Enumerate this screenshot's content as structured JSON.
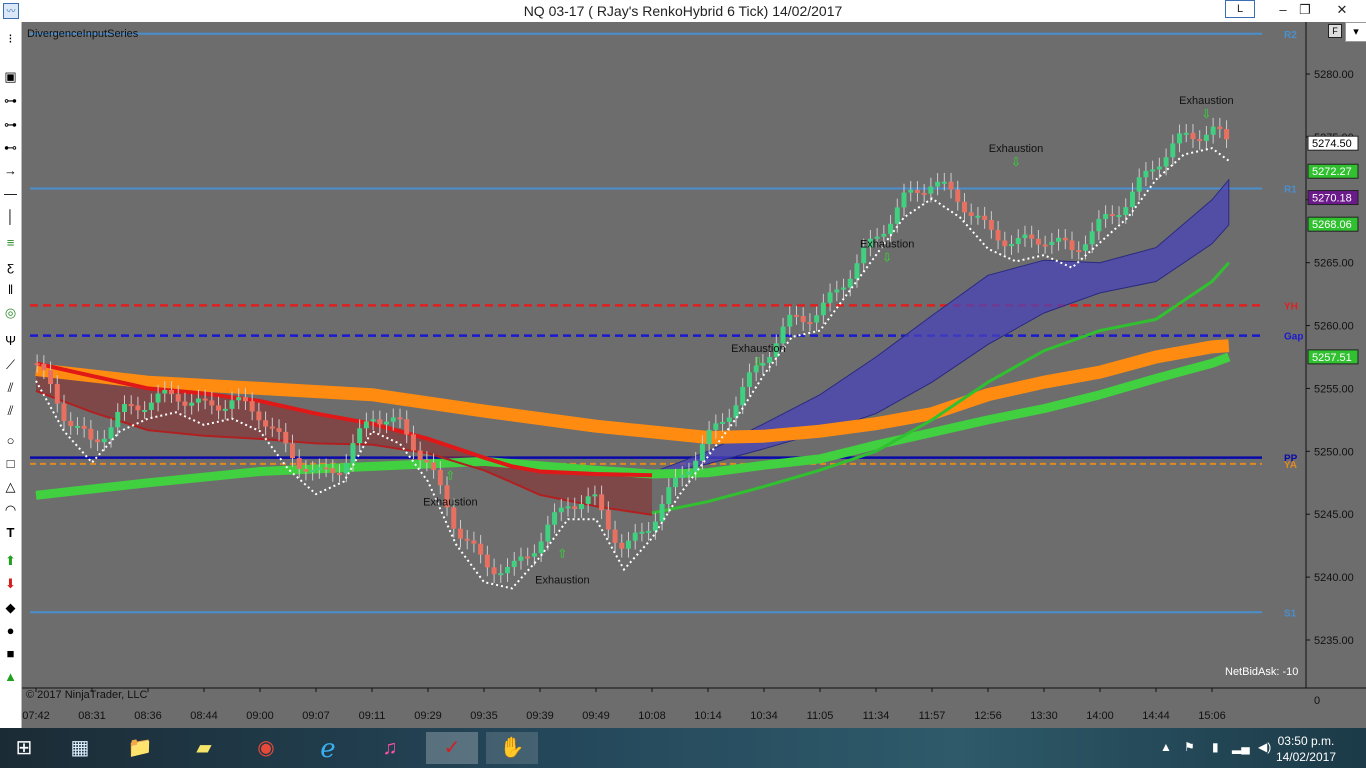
{
  "window": {
    "title": "NQ 03-17 ( RJay's RenkoHybrid  6 Tick)  14/02/2017",
    "badge": "L",
    "minimize": "–",
    "maximize": "❐",
    "close": "✕"
  },
  "chart": {
    "indicator_label": "DivergenceInputSeries",
    "copyright": "© 2017 NinjaTrader, LLC",
    "netbid": "NetBidAsk: -10",
    "f_button": "F",
    "dropdown": "▾",
    "colors": {
      "background": "#6d6d6d",
      "level_blue": "#4a8fd0",
      "yh": "#e02020",
      "gap": "#1a1ad0",
      "pp": "#0a0aa8",
      "ya": "#e08a20",
      "orange_band": "#ff8c10",
      "green_band": "#40d040",
      "up_candle": "#40d080",
      "down_candle": "#e87060"
    }
  },
  "chart_data": {
    "type": "line",
    "title": "NQ 03-17 ( RJay's RenkoHybrid  6 Tick)  14/02/2017",
    "x_ticks": [
      "07:42",
      "08:31",
      "08:36",
      "08:44",
      "09:00",
      "09:07",
      "09:11",
      "09:29",
      "09:35",
      "09:39",
      "09:49",
      "10:08",
      "10:14",
      "10:34",
      "11:05",
      "11:34",
      "11:57",
      "12:56",
      "13:30",
      "14:00",
      "14:44",
      "15:06"
    ],
    "y_ticks": [
      "5280.00",
      "5275.00",
      "5270.00",
      "5265.00",
      "5260.00",
      "5255.00",
      "5250.00",
      "5245.00",
      "5240.00",
      "5235.00"
    ],
    "ylim": [
      5231.5,
      5283.5
    ],
    "levels": [
      {
        "name": "R2",
        "value": 5283.2
      },
      {
        "name": "R1",
        "value": 5270.9
      },
      {
        "name": "YH",
        "value": 5261.6
      },
      {
        "name": "Gap",
        "value": 5259.2
      },
      {
        "name": "PP",
        "value": 5249.5
      },
      {
        "name": "YA",
        "value": 5249.0
      },
      {
        "name": "S1",
        "value": 5237.2
      }
    ],
    "price_tags": [
      {
        "label": "5274.50",
        "value": 5274.5,
        "color": "#ffffff",
        "text": "#000000"
      },
      {
        "label": "5272.27",
        "value": 5272.27,
        "color": "#30c030",
        "text": "#ffffff"
      },
      {
        "label": "5270.18",
        "value": 5270.18,
        "color": "#6a1a8a",
        "text": "#ffffff"
      },
      {
        "label": "5268.06",
        "value": 5268.06,
        "color": "#30c030",
        "text": "#ffffff"
      },
      {
        "label": "5257.51",
        "value": 5257.51,
        "color": "#30c030",
        "text": "#ffffff"
      }
    ],
    "annotations": [
      {
        "text": "Exhaustion",
        "x_index": 20.9,
        "value": 5277.6,
        "arrow": "down"
      },
      {
        "text": "Exhaustion",
        "x_index": 17.5,
        "value": 5273.8,
        "arrow": "down"
      },
      {
        "text": "Exhaustion",
        "x_index": 15.2,
        "value": 5266.2,
        "arrow": "down"
      },
      {
        "text": "Exhaustion",
        "x_index": 12.9,
        "value": 5257.9,
        "arrow": "down"
      },
      {
        "text": "Exhaustion",
        "x_index": 7.4,
        "value": 5245.7,
        "arrow": "up"
      },
      {
        "text": "Exhaustion",
        "x_index": 9.4,
        "value": 5239.5,
        "arrow": "up"
      }
    ],
    "series": [
      {
        "name": "close",
        "x": [
          0,
          0.5,
          1,
          1.5,
          2,
          2.5,
          3,
          3.5,
          4,
          4.5,
          5,
          5.5,
          6,
          6.5,
          7,
          7.5,
          8,
          8.5,
          9,
          9.5,
          10,
          10.5,
          11,
          11.5,
          12,
          12.5,
          13,
          13.5,
          14,
          14.5,
          15,
          15.5,
          16,
          16.5,
          17,
          17.5,
          18,
          18.5,
          19,
          19.5,
          20,
          20.5,
          21,
          21.3
        ],
        "y": [
          5257,
          5253,
          5250.5,
          5253,
          5254,
          5254.5,
          5253.5,
          5254,
          5253,
          5250,
          5248,
          5249,
          5253,
          5252,
          5249,
          5244,
          5241,
          5240.5,
          5243,
          5246,
          5246,
          5242,
          5244.5,
          5248,
          5251,
          5254,
          5257.5,
          5260.5,
          5261,
          5264,
          5267,
          5270,
          5271.5,
          5270,
          5267.5,
          5266.5,
          5267,
          5266,
          5268,
          5270,
          5273,
          5275,
          5275.5,
          5274.5
        ]
      },
      {
        "name": "orange_band",
        "x": [
          0,
          2,
          4,
          6,
          8,
          10,
          12,
          13,
          14,
          15,
          16,
          17,
          18,
          19,
          20,
          21,
          21.3
        ],
        "y": [
          5256.5,
          5255.5,
          5255,
          5254.5,
          5253.2,
          5252,
          5251.1,
          5251.2,
          5251.6,
          5252.2,
          5253,
          5254.5,
          5255.5,
          5256.3,
          5257.5,
          5258.3,
          5258.4
        ]
      },
      {
        "name": "green_band",
        "x": [
          0,
          2,
          4,
          6,
          8,
          10,
          11,
          12,
          13,
          14,
          15,
          16,
          17,
          18,
          19,
          20,
          21,
          21.3
        ],
        "y": [
          5246.5,
          5247.5,
          5248.4,
          5248.8,
          5249.2,
          5248.5,
          5248.2,
          5248.3,
          5248.9,
          5249.4,
          5250.5,
          5251.5,
          5252.5,
          5253.4,
          5254.5,
          5255.8,
          5257,
          5257.5
        ]
      },
      {
        "name": "red_band",
        "x": [
          0,
          1,
          2,
          3,
          4,
          5,
          6,
          7,
          8,
          8.5,
          9,
          10,
          11
        ],
        "y": [
          5257,
          5256,
          5255,
          5254.6,
          5254,
          5253,
          5252.2,
          5251,
          5249.5,
          5248.8,
          5248.4,
          5248.2,
          5248.1
        ]
      },
      {
        "name": "purple_upper",
        "x": [
          11,
          12,
          13,
          14,
          15,
          16,
          17,
          18,
          19,
          20,
          21,
          21.3
        ],
        "y": [
          5248.3,
          5250,
          5252.2,
          5254.5,
          5257.5,
          5260.8,
          5264,
          5265.2,
          5265,
          5266.2,
          5270,
          5271.6
        ]
      },
      {
        "name": "purple_lower",
        "x": [
          11,
          12,
          13,
          14,
          15,
          16,
          17,
          18,
          19,
          20,
          21,
          21.3
        ],
        "y": [
          5248.1,
          5249,
          5250.2,
          5251.5,
          5253,
          5255.5,
          5258.5,
          5261,
          5262.6,
          5263.5,
          5266.5,
          5268
        ]
      }
    ],
    "xlabel": "",
    "ylabel": ""
  },
  "taskbar": {
    "items": [
      {
        "name": "start-icon",
        "glyph": "⊞"
      },
      {
        "name": "calculator-icon",
        "glyph": "▦"
      },
      {
        "name": "file-explorer-icon",
        "glyph": "📁"
      },
      {
        "name": "sticky-notes-icon",
        "glyph": "▰"
      },
      {
        "name": "chrome-icon",
        "glyph": "◉"
      },
      {
        "name": "internet-explorer-icon",
        "glyph": "ℯ"
      },
      {
        "name": "itunes-icon",
        "glyph": "♫"
      },
      {
        "name": "ninjatrader-icon",
        "glyph": "✓"
      },
      {
        "name": "hand-app-icon",
        "glyph": "✋"
      }
    ],
    "time": "03:50 p.m.",
    "date": "14/02/2017"
  }
}
